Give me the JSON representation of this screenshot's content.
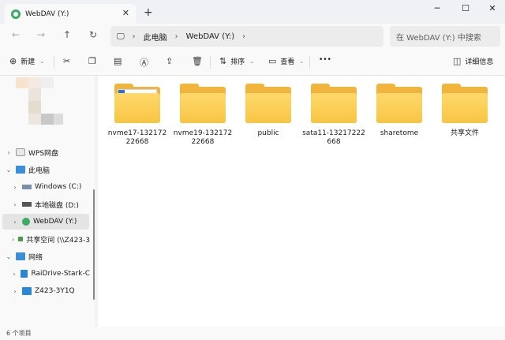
{
  "window": {
    "tab_title": "WebDAV (Y:)",
    "tab_close": "✕",
    "new_tab": "+",
    "minimize": "─",
    "maximize": "☐",
    "close": "✕"
  },
  "nav": {
    "back": "←",
    "forward": "→",
    "up": "↑",
    "refresh": "↻",
    "monitor_icon": "🖵",
    "breadcrumb": [
      "此电脑",
      "WebDAV (Y:)"
    ],
    "sep": "›",
    "search_placeholder": "在 WebDAV (Y:) 中搜索"
  },
  "commands": {
    "new": "新建",
    "sort": "排序",
    "view": "查看",
    "more": "•••",
    "details": "详细信息"
  },
  "sidebar": {
    "items": [
      {
        "label": "WPS网盘"
      },
      {
        "label": "此电脑"
      },
      {
        "label": "Windows (C:)"
      },
      {
        "label": "本地磁盘 (D:)"
      },
      {
        "label": "WebDAV (Y:)"
      },
      {
        "label": "共享空间 (\\\\Z423-3"
      },
      {
        "label": "网络"
      },
      {
        "label": "RaiDrive-Stark-C"
      },
      {
        "label": "Z423-3Y1Q"
      }
    ]
  },
  "folders": [
    {
      "name": "nvme17-13217222668",
      "has_doc": true
    },
    {
      "name": "nvme19-13217222668",
      "has_doc": false
    },
    {
      "name": "public",
      "has_doc": false
    },
    {
      "name": "sata11-13217222668",
      "has_doc": false
    },
    {
      "name": "sharetome",
      "has_doc": false
    },
    {
      "name": "共享文件",
      "has_doc": false
    }
  ],
  "status": {
    "item_count": "6 个项目"
  },
  "colors": {
    "folder": "#f7c543",
    "accent": "#005fb8",
    "webdav_icon": "#3eaa62"
  }
}
